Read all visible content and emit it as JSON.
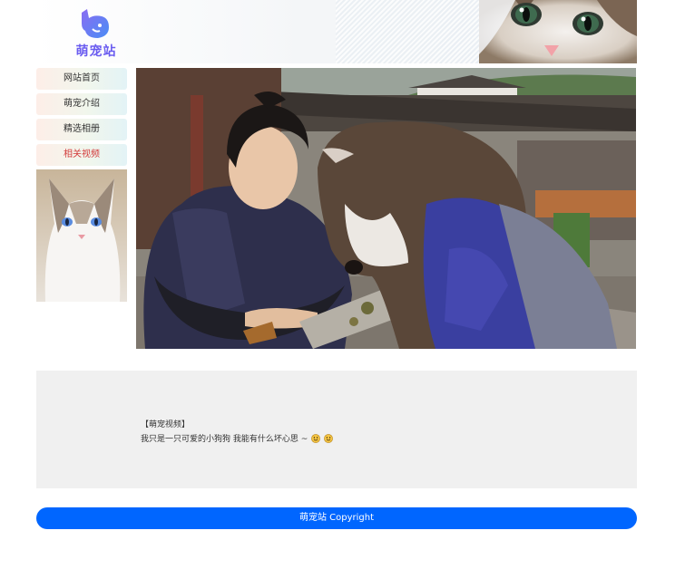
{
  "site": {
    "logo_text": "萌宠站",
    "brand_color": "#6a5cf0",
    "accent_color": "#0066ff"
  },
  "sidebar": {
    "items": [
      {
        "label": "网站首页",
        "active": false
      },
      {
        "label": "萌宠介绍",
        "active": false
      },
      {
        "label": "精选相册",
        "active": false
      },
      {
        "label": "相关视频",
        "active": true
      }
    ],
    "active_color": "#d23a3a"
  },
  "video": {
    "icon": "video-player-icon"
  },
  "caption": {
    "title": "【萌宠视频】",
    "text": "我只是一只可爱的小狗狗 我能有什么坏心思 ~",
    "emoji_icon": "smiling-face-icon"
  },
  "footer": {
    "text": "萌宠站 Copyright"
  }
}
